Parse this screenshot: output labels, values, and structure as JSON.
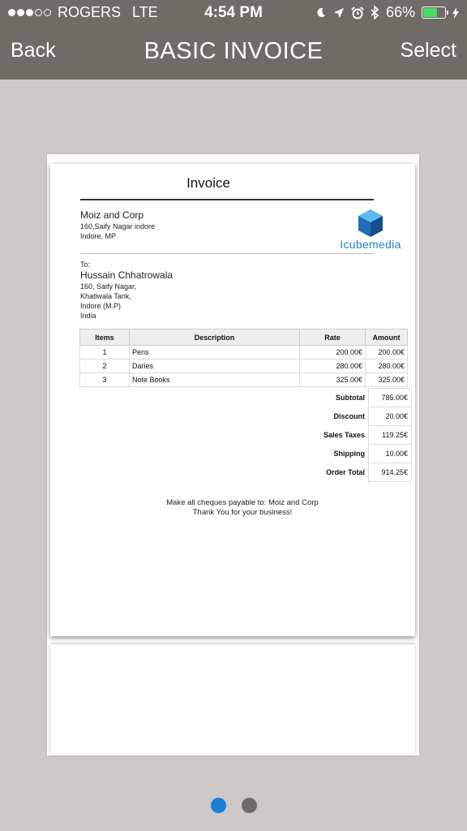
{
  "status_bar": {
    "carrier": "ROGERS",
    "network": "LTE",
    "time": "4:54 PM",
    "battery": "66%",
    "battery_level": 0.66,
    "icons": [
      "moon-icon",
      "location-arrow-icon",
      "alarm-clock-icon",
      "bluetooth-icon",
      "charging-icon"
    ]
  },
  "nav": {
    "back_label": "Back",
    "title": "BASIC INVOICE",
    "select_label": "Select"
  },
  "invoice": {
    "title": "Invoice",
    "from": {
      "name": "Moiz and Corp",
      "line1": "160,Saify Nagar indore",
      "line2": "Indore, MP"
    },
    "logo_text": "Icubemedia",
    "to_label": "To:",
    "to": {
      "name": "Hussain Chhatrowala",
      "line1": "160, Saify Nagar,",
      "line2": "Khatiwala Tank,",
      "line3": "Indore (M.P)",
      "line4": "India"
    },
    "columns": {
      "items": "Items",
      "description": "Description",
      "rate": "Rate",
      "amount": "Amount"
    },
    "rows": [
      {
        "item": "1",
        "description": "Pens",
        "rate": "200.00€",
        "amount": "200.00€"
      },
      {
        "item": "2",
        "description": "Daries",
        "rate": "280.00€",
        "amount": "280.00€"
      },
      {
        "item": "3",
        "description": "Note Books",
        "rate": "325.00€",
        "amount": "325.00€"
      }
    ],
    "totals": [
      {
        "label": "Subtotal",
        "value": "785.00€"
      },
      {
        "label": "Discount",
        "value": "20.00€"
      },
      {
        "label": "Sales Taxes",
        "value": "119.25€"
      },
      {
        "label": "Shipping",
        "value": "10.00€"
      },
      {
        "label": "Order Total",
        "value": "914.25€"
      }
    ],
    "footer_line1": "Make all cheques payable to: Moiz and Corp",
    "footer_line2": "Thank You for your business!"
  },
  "pager": {
    "active_color": "#1a7fd4",
    "inactive_color": "#6f6b66",
    "pages": 2,
    "current": 1
  }
}
